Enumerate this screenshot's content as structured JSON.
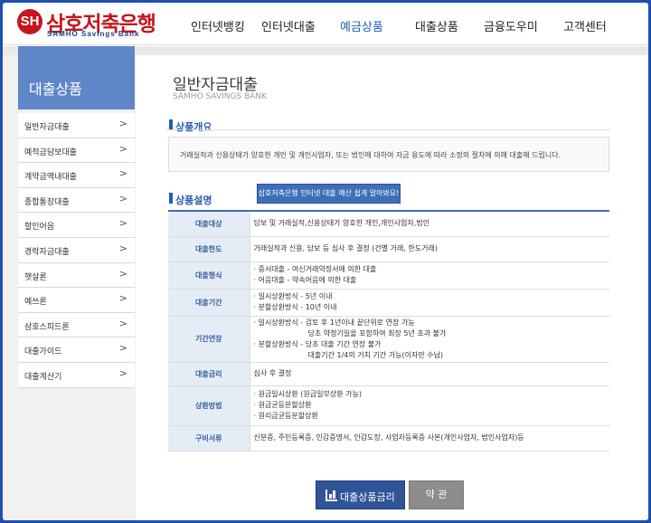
{
  "header": {
    "logo": {
      "seal": "SH",
      "brand": "삼호저축은행",
      "sub": "SAMHO Savings Bank"
    },
    "menu": [
      "인터넷뱅킹",
      "인터넷대출",
      "예금상품",
      "대출상품",
      "금융도우미",
      "고객센터"
    ],
    "active_menu": "예금상품"
  },
  "sidebar": {
    "title": "대출상품",
    "items": [
      "일반자금대출",
      "예적금담보대출",
      "계약금액내대출",
      "종합통장대출",
      "할인어음",
      "경락자금대출",
      "햇살론",
      "예쓰론",
      "삼호스피드론",
      "대출가이드",
      "대출계산기"
    ]
  },
  "page": {
    "title": "일반자금대출",
    "subtitle": "SAMHO SAVINGS BANK",
    "overview_title": "상품개요",
    "overview_text": "거래실적과 신용상태가 양호한 개인 및 개인사업자, 또는 법인에 대하여 자금 용도에 따라 소정의 절차에 의해 대출해 드립니다.",
    "desc_title": "상품설명",
    "notice_button": "삼호저축은행 인터넷 대출 예산 쉽게 알아봐요!",
    "rows": [
      {
        "label": "대출대상",
        "lines": [
          "담보 및 거래실적,신용상태가 양호한 개인,개인사업자,법인"
        ]
      },
      {
        "label": "대출한도",
        "lines": [
          "거래실적과 신용, 담보 등 심사 후 결정 (건별 거래, 한도거래)"
        ]
      },
      {
        "label": "대출형식",
        "lines": [
          "· 증서대출 - 여신거래약정서에 의한 대출",
          "· 어음대출 - 약속어음에 의한 대출"
        ]
      },
      {
        "label": "대출기간",
        "lines": [
          "· 일시상환방식 - 5년 이내",
          "· 분할상환방식 - 10년 이내"
        ]
      },
      {
        "label": "기간연장",
        "lines": [
          "· 일시상환방식 - 검토 후 1년이내 끝단위로 연장 가능",
          "당초 약정기일을 포함하여 최장 5년 초과 불가",
          "· 분할상환방식 - 당초 대출 기간 연장 불가",
          "대출기간 1/4의 거치 기간 가능(이자만 수납)"
        ]
      },
      {
        "label": "대출금리",
        "lines": [
          "심사 후 결정"
        ]
      },
      {
        "label": "상환방법",
        "lines": [
          "· 원금일시상환 (원금일부상환 가능)",
          "· 원금균등분할상환",
          "· 원리금균등분할상환"
        ]
      },
      {
        "label": "구비서류",
        "lines": [
          "신분증, 주민등록증, 인감증명서, 인감도장, 사업자등록증 사본(개인사업자, 법인사업자)등"
        ]
      }
    ],
    "rate_button": "대출상품금리",
    "terms_button": "약 관"
  },
  "colors": {
    "brand_red": "#c4161c",
    "brand_blue": "#1b3f8f",
    "accent": "#1d5fb5",
    "sidebar_head": "#5f86c7"
  }
}
